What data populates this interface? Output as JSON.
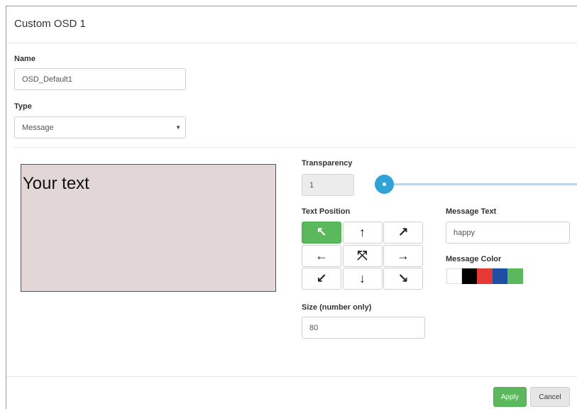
{
  "dialog": {
    "title": "Custom OSD 1"
  },
  "name": {
    "label": "Name",
    "value": "OSD_Default1"
  },
  "type": {
    "label": "Type",
    "selected": "Message",
    "caret_icon": "caret-down-icon"
  },
  "preview": {
    "text": "Your text"
  },
  "transparency": {
    "label": "Transparency",
    "value": "1",
    "slider_level": 0
  },
  "text_position": {
    "label": "Text Position",
    "active": "top-left",
    "buttons": [
      {
        "id": "top-left",
        "glyph": "↖",
        "icon": "arrow-up-left-icon"
      },
      {
        "id": "top",
        "glyph": "↑",
        "icon": "arrow-up-icon"
      },
      {
        "id": "top-right",
        "glyph": "↗",
        "icon": "arrow-up-right-icon"
      },
      {
        "id": "left",
        "glyph": "←",
        "icon": "arrow-left-icon"
      },
      {
        "id": "center",
        "glyph": "⤧",
        "icon": "collapse-center-icon"
      },
      {
        "id": "right",
        "glyph": "→",
        "icon": "arrow-right-icon"
      },
      {
        "id": "bottom-left",
        "glyph": "↙",
        "icon": "arrow-down-left-icon"
      },
      {
        "id": "bottom",
        "glyph": "↓",
        "icon": "arrow-down-icon"
      },
      {
        "id": "bottom-right",
        "glyph": "↘",
        "icon": "arrow-down-right-icon"
      }
    ]
  },
  "message_text": {
    "label": "Message Text",
    "value": "happy"
  },
  "message_color": {
    "label": "Message Color",
    "swatches": [
      "#ffffff",
      "#000000",
      "#e53935",
      "#1e4fa3",
      "#5cb85c"
    ]
  },
  "size": {
    "label": "Size (number only)",
    "value": "80"
  },
  "footer": {
    "apply_label": "Apply",
    "cancel_label": "Cancel"
  },
  "colors": {
    "accent": "#5cb85c",
    "slider": "#30a2d6",
    "preview_bg": "#e3d6d6"
  }
}
